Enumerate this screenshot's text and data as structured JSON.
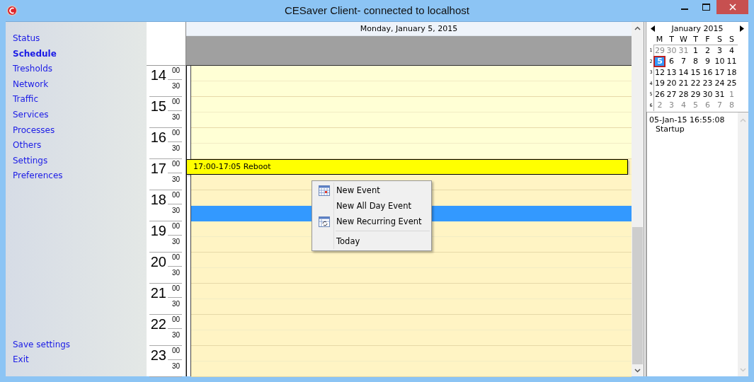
{
  "window": {
    "title": "CESaver Client- connected to localhost"
  },
  "sidebar": {
    "items": [
      {
        "label": "Status",
        "selected": false
      },
      {
        "label": "Schedule",
        "selected": true
      },
      {
        "label": "Tresholds",
        "selected": false
      },
      {
        "label": "Network",
        "selected": false
      },
      {
        "label": "Traffic",
        "selected": false
      },
      {
        "label": "Services",
        "selected": false
      },
      {
        "label": "Processes",
        "selected": false
      },
      {
        "label": "Others",
        "selected": false
      },
      {
        "label": "Settings",
        "selected": false
      },
      {
        "label": "Preferences",
        "selected": false
      }
    ],
    "bottom_items": [
      {
        "label": "Save settings"
      },
      {
        "label": "Exit"
      }
    ]
  },
  "day_view": {
    "date": "Monday, January 5, 2015",
    "hours": [
      {
        "hour": "14",
        "slots": [
          {
            "minute": "00",
            "working": false,
            "selected": false
          },
          {
            "minute": "30",
            "working": false,
            "selected": false
          }
        ]
      },
      {
        "hour": "15",
        "slots": [
          {
            "minute": "00",
            "working": false,
            "selected": false
          },
          {
            "minute": "30",
            "working": false,
            "selected": false
          }
        ]
      },
      {
        "hour": "16",
        "slots": [
          {
            "minute": "00",
            "working": false,
            "selected": false
          },
          {
            "minute": "30",
            "working": false,
            "selected": false
          }
        ]
      },
      {
        "hour": "17",
        "slots": [
          {
            "minute": "00",
            "working": true,
            "selected": false,
            "event": "17:00-17:05 Reboot"
          },
          {
            "minute": "30",
            "working": true,
            "selected": false
          }
        ]
      },
      {
        "hour": "18",
        "slots": [
          {
            "minute": "00",
            "working": true,
            "selected": false
          },
          {
            "minute": "30",
            "working": true,
            "selected": true
          }
        ]
      },
      {
        "hour": "19",
        "slots": [
          {
            "minute": "00",
            "working": true,
            "selected": false
          },
          {
            "minute": "30",
            "working": true,
            "selected": false
          }
        ]
      },
      {
        "hour": "20",
        "slots": [
          {
            "minute": "00",
            "working": true,
            "selected": false
          },
          {
            "minute": "30",
            "working": true,
            "selected": false
          }
        ]
      },
      {
        "hour": "21",
        "slots": [
          {
            "minute": "00",
            "working": true,
            "selected": false
          },
          {
            "minute": "30",
            "working": true,
            "selected": false
          }
        ]
      },
      {
        "hour": "22",
        "slots": [
          {
            "minute": "00",
            "working": true,
            "selected": false
          },
          {
            "minute": "30",
            "working": true,
            "selected": false
          }
        ]
      },
      {
        "hour": "23",
        "slots": [
          {
            "minute": "00",
            "working": true,
            "selected": false
          },
          {
            "minute": "30",
            "working": true,
            "selected": false
          }
        ]
      }
    ]
  },
  "context_menu": {
    "items": [
      {
        "label": "New Event",
        "kind": "calendar"
      },
      {
        "label": "New All Day Event",
        "kind": "plain"
      },
      {
        "label": "New Recurring Event",
        "kind": "recurring"
      },
      {
        "kind": "separator"
      },
      {
        "label": "Today",
        "kind": "plain"
      }
    ]
  },
  "mini_calendar": {
    "month": "January 2015",
    "weekdays": [
      "M",
      "T",
      "W",
      "T",
      "F",
      "S",
      "S"
    ],
    "weeks": [
      {
        "number": "1",
        "days": [
          {
            "day": "29",
            "other_month": true,
            "selected": false
          },
          {
            "day": "30",
            "other_month": true,
            "selected": false
          },
          {
            "day": "31",
            "other_month": true,
            "selected": false
          },
          {
            "day": "1",
            "other_month": false,
            "selected": false
          },
          {
            "day": "2",
            "other_month": false,
            "selected": false
          },
          {
            "day": "3",
            "other_month": false,
            "selected": false
          },
          {
            "day": "4",
            "other_month": false,
            "selected": false
          }
        ]
      },
      {
        "number": "2",
        "days": [
          {
            "day": "5",
            "other_month": false,
            "selected": true
          },
          {
            "day": "6",
            "other_month": false,
            "selected": false
          },
          {
            "day": "7",
            "other_month": false,
            "selected": false
          },
          {
            "day": "8",
            "other_month": false,
            "selected": false
          },
          {
            "day": "9",
            "other_month": false,
            "selected": false
          },
          {
            "day": "10",
            "other_month": false,
            "selected": false
          },
          {
            "day": "11",
            "other_month": false,
            "selected": false
          }
        ]
      },
      {
        "number": "3",
        "days": [
          {
            "day": "12",
            "other_month": false,
            "selected": false
          },
          {
            "day": "13",
            "other_month": false,
            "selected": false
          },
          {
            "day": "14",
            "other_month": false,
            "selected": false
          },
          {
            "day": "15",
            "other_month": false,
            "selected": false
          },
          {
            "day": "16",
            "other_month": false,
            "selected": false
          },
          {
            "day": "17",
            "other_month": false,
            "selected": false
          },
          {
            "day": "18",
            "other_month": false,
            "selected": false
          }
        ]
      },
      {
        "number": "4",
        "days": [
          {
            "day": "19",
            "other_month": false,
            "selected": false
          },
          {
            "day": "20",
            "other_month": false,
            "selected": false
          },
          {
            "day": "21",
            "other_month": false,
            "selected": false
          },
          {
            "day": "22",
            "other_month": false,
            "selected": false
          },
          {
            "day": "23",
            "other_month": false,
            "selected": false
          },
          {
            "day": "24",
            "other_month": false,
            "selected": false
          },
          {
            "day": "25",
            "other_month": false,
            "selected": false
          }
        ]
      },
      {
        "number": "5",
        "days": [
          {
            "day": "26",
            "other_month": false,
            "selected": false
          },
          {
            "day": "27",
            "other_month": false,
            "selected": false
          },
          {
            "day": "28",
            "other_month": false,
            "selected": false
          },
          {
            "day": "29",
            "other_month": false,
            "selected": false
          },
          {
            "day": "30",
            "other_month": false,
            "selected": false
          },
          {
            "day": "31",
            "other_month": false,
            "selected": false
          },
          {
            "day": "1",
            "other_month": true,
            "selected": false
          }
        ]
      },
      {
        "number": "6",
        "days": [
          {
            "day": "2",
            "other_month": true,
            "selected": false
          },
          {
            "day": "3",
            "other_month": true,
            "selected": false
          },
          {
            "day": "4",
            "other_month": true,
            "selected": false
          },
          {
            "day": "5",
            "other_month": true,
            "selected": false
          },
          {
            "day": "6",
            "other_month": true,
            "selected": false
          },
          {
            "day": "7",
            "other_month": true,
            "selected": false
          },
          {
            "day": "8",
            "other_month": true,
            "selected": false
          }
        ]
      }
    ]
  },
  "log": {
    "entries": [
      {
        "time": "05-Jan-15 16:55:08",
        "message": "Startup"
      }
    ]
  }
}
